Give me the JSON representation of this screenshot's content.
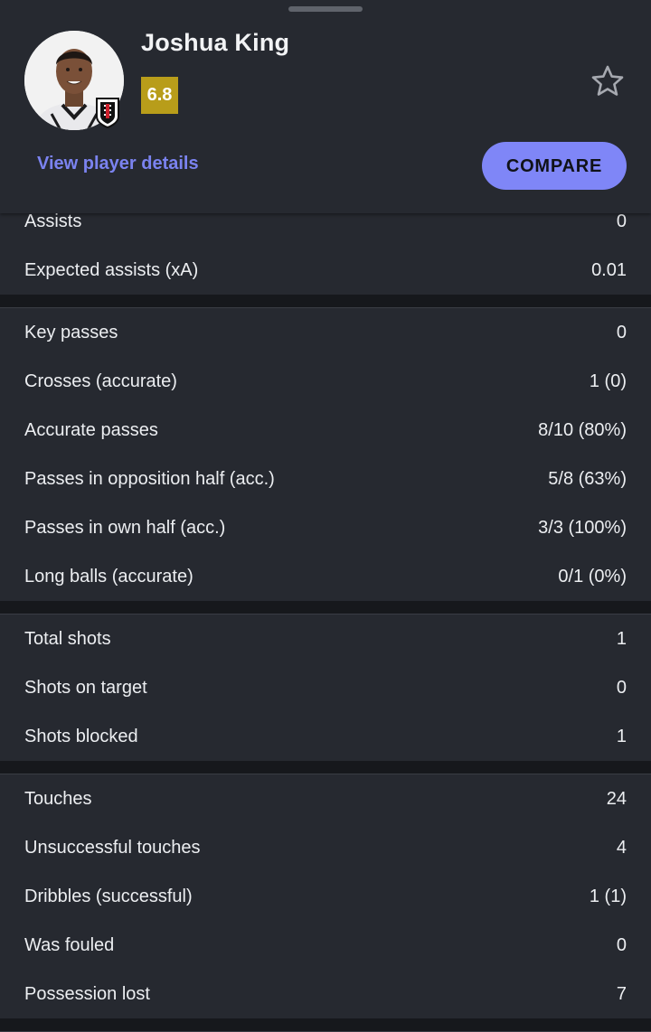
{
  "player": {
    "name": "Joshua King",
    "rating": "6.8",
    "rating_color": "#b89d1a",
    "avatar_icon": "player-photo",
    "club_icon": "fulham-crest-icon"
  },
  "actions": {
    "view_details": "View player details",
    "compare": "COMPARE",
    "favorite_icon": "star-outline-icon"
  },
  "colors": {
    "accent": "#7f86f7",
    "link": "#7b83f0",
    "background": "#262930"
  },
  "groups": [
    {
      "rows": [
        {
          "label": "Assists",
          "value": "0"
        },
        {
          "label": "Expected assists (xA)",
          "value": "0.01"
        }
      ]
    },
    {
      "rows": [
        {
          "label": "Key passes",
          "value": "0"
        },
        {
          "label": "Crosses (accurate)",
          "value": "1 (0)"
        },
        {
          "label": "Accurate passes",
          "value": "8/10 (80%)"
        },
        {
          "label": "Passes in opposition half (acc.)",
          "value": "5/8 (63%)"
        },
        {
          "label": "Passes in own half (acc.)",
          "value": "3/3 (100%)"
        },
        {
          "label": "Long balls (accurate)",
          "value": "0/1 (0%)"
        }
      ]
    },
    {
      "rows": [
        {
          "label": "Total shots",
          "value": "1"
        },
        {
          "label": "Shots on target",
          "value": "0"
        },
        {
          "label": "Shots blocked",
          "value": "1"
        }
      ]
    },
    {
      "rows": [
        {
          "label": "Touches",
          "value": "24"
        },
        {
          "label": "Unsuccessful touches",
          "value": "4"
        },
        {
          "label": "Dribbles (successful)",
          "value": "1 (1)"
        },
        {
          "label": "Was fouled",
          "value": "0"
        },
        {
          "label": "Possession lost",
          "value": "7"
        }
      ]
    }
  ]
}
